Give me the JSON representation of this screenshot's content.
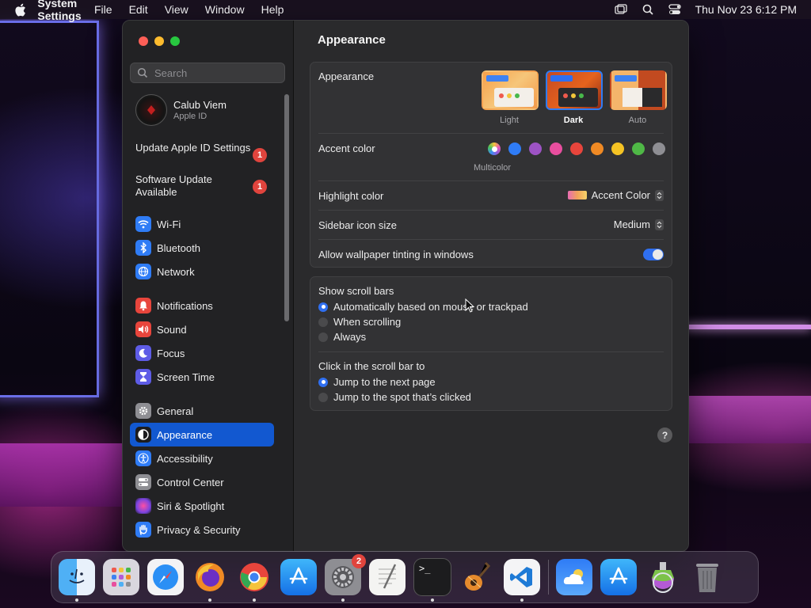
{
  "menubar": {
    "app_name": "System Settings",
    "menus": [
      "File",
      "Edit",
      "View",
      "Window",
      "Help"
    ],
    "clock": "Thu Nov 23  6:12 PM"
  },
  "sidebar": {
    "search_placeholder": "Search",
    "profile": {
      "name": "Calub Viem",
      "subtitle": "Apple ID"
    },
    "notices": [
      {
        "label": "Update Apple ID Settings",
        "badge": "1"
      },
      {
        "label": "Software Update Available",
        "badge": "1"
      }
    ],
    "groups": [
      [
        {
          "label": "Wi-Fi",
          "icon": "wifi-icon",
          "color": "#2f7cf6"
        },
        {
          "label": "Bluetooth",
          "icon": "bluetooth-icon",
          "color": "#2f7cf6"
        },
        {
          "label": "Network",
          "icon": "globe-icon",
          "color": "#2f7cf6"
        }
      ],
      [
        {
          "label": "Notifications",
          "icon": "bell-icon",
          "color": "#e8453c"
        },
        {
          "label": "Sound",
          "icon": "speaker-icon",
          "color": "#e8453c"
        },
        {
          "label": "Focus",
          "icon": "moon-icon",
          "color": "#5e5ce6"
        },
        {
          "label": "Screen Time",
          "icon": "hourglass-icon",
          "color": "#5e5ce6"
        }
      ],
      [
        {
          "label": "General",
          "icon": "gear-icon",
          "color": "#8e8e93"
        },
        {
          "label": "Appearance",
          "icon": "appearance-icon",
          "color": "#1c1c1e",
          "selected": true
        },
        {
          "label": "Accessibility",
          "icon": "accessibility-icon",
          "color": "#2f7cf6"
        },
        {
          "label": "Control Center",
          "icon": "control-center-icon",
          "color": "#8e8e93"
        },
        {
          "label": "Siri & Spotlight",
          "icon": "siri-icon",
          "color": "#b34bd6"
        },
        {
          "label": "Privacy & Security",
          "icon": "hand-icon",
          "color": "#2f7cf6"
        }
      ]
    ]
  },
  "main": {
    "title": "Appearance",
    "appearance": {
      "label": "Appearance",
      "options": [
        {
          "label": "Light",
          "selected": false
        },
        {
          "label": "Dark",
          "selected": true
        },
        {
          "label": "Auto",
          "selected": false
        }
      ]
    },
    "accent": {
      "label": "Accent color",
      "selected_caption": "Multicolor",
      "colors": [
        "#f07fc0",
        "#2f7cf6",
        "#9d53c4",
        "#e84e9e",
        "#e8453c",
        "#f08a24",
        "#f5c324",
        "#4fb846",
        "#8e8e93"
      ]
    },
    "highlight": {
      "label": "Highlight color",
      "value": "Accent Color"
    },
    "icon_size": {
      "label": "Sidebar icon size",
      "value": "Medium"
    },
    "tinting": {
      "label": "Allow wallpaper tinting in windows",
      "enabled": true
    },
    "scroll_bars": {
      "label": "Show scroll bars",
      "options": [
        {
          "label": "Automatically based on mouse or trackpad",
          "selected": true
        },
        {
          "label": "When scrolling",
          "selected": false
        },
        {
          "label": "Always",
          "selected": false
        }
      ]
    },
    "click_scroll": {
      "label": "Click in the scroll bar to",
      "options": [
        {
          "label": "Jump to the next page",
          "selected": true
        },
        {
          "label": "Jump to the spot that’s clicked",
          "selected": false
        }
      ]
    },
    "help": "?"
  },
  "dock": {
    "apps": [
      "finder-icon",
      "launchpad-icon",
      "safari-icon",
      "firefox-icon",
      "chrome-icon",
      "app-store-icon",
      "system-settings-icon",
      "textedit-icon",
      "terminal-icon",
      "garageband-icon",
      "vscode-icon"
    ],
    "extras": [
      "weather-icon",
      "app-store-2-icon",
      "installer-icon",
      "trash-icon"
    ],
    "settings_badge": "2",
    "terminal_prompt": ">_"
  }
}
